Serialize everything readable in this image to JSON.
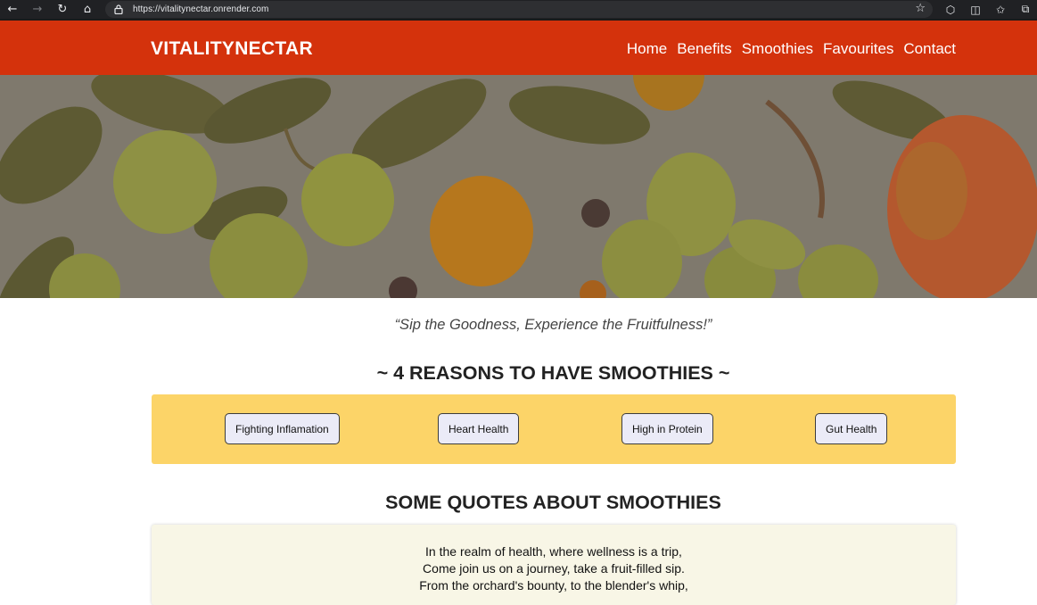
{
  "browser": {
    "url": "https://vitalitynectar.onrender.com",
    "icons": [
      "back-icon",
      "forward-icon",
      "reload-icon",
      "home-icon",
      "lock-icon",
      "star-icon",
      "extensions-icon",
      "split-screen-icon",
      "favorites-icon",
      "collections-icon"
    ]
  },
  "header": {
    "logo_part1": "VITALITY",
    "logo_part2": "NECTAR",
    "nav": [
      "Home",
      "Benefits",
      "Smoothies",
      "Favourites",
      "Contact"
    ],
    "bg_color": "#d4320c"
  },
  "tagline": "“Sip the Goodness, Experience the Fruitfulness!”",
  "reasons": {
    "title": "~ 4 REASONS TO HAVE SMOOTHIES ~",
    "buttons": [
      "Fighting Inflamation",
      "Heart Health",
      "High in Protein",
      "Gut Health"
    ],
    "bg_color": "#fcd468"
  },
  "quotes": {
    "title": "SOME QUOTES ABOUT SMOOTHIES",
    "lines": [
      "In the realm of health, where wellness is a trip,",
      "Come join us on a journey, take a fruit-filled sip.",
      "From the orchard's bounty, to the blender's whip,"
    ]
  }
}
